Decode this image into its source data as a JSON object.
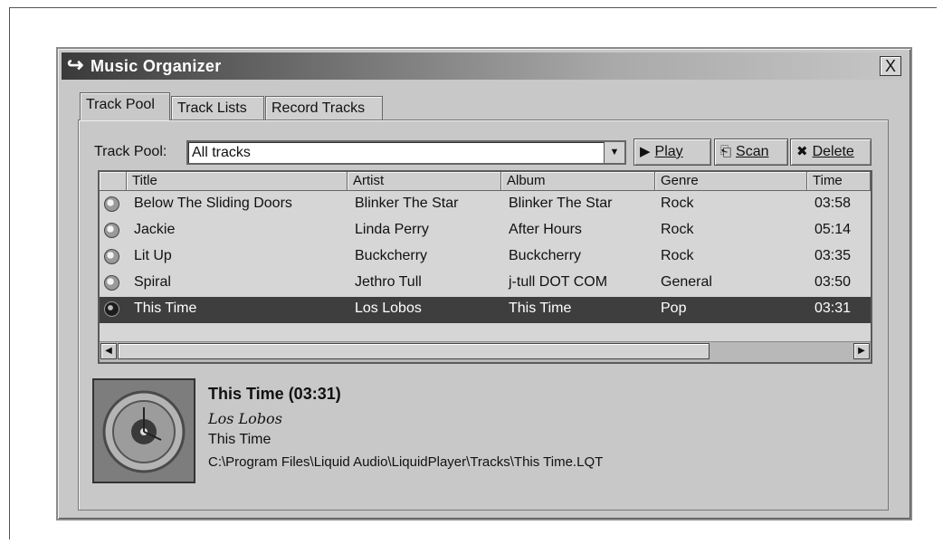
{
  "window": {
    "title": "Music Organizer",
    "close_label": "X"
  },
  "tabs": [
    {
      "label": "Track Pool",
      "active": true
    },
    {
      "label": "Track Lists",
      "active": false
    },
    {
      "label": "Record Tracks",
      "active": false
    }
  ],
  "track_pool": {
    "label": "Track Pool:",
    "selected": "All tracks"
  },
  "buttons": {
    "play": {
      "label": "Play",
      "icon": "play-icon"
    },
    "scan": {
      "label": "Scan",
      "icon": "scan-icon"
    },
    "delete": {
      "label": "Delete",
      "icon": "delete-icon"
    }
  },
  "table": {
    "columns": [
      "Title",
      "Artist",
      "Album",
      "Genre",
      "Time"
    ],
    "rows": [
      {
        "title": "Below The Sliding Doors",
        "artist": "Blinker The Star",
        "album": "Blinker The Star",
        "genre": "Rock",
        "time": "03:58",
        "selected": false
      },
      {
        "title": "Jackie",
        "artist": "Linda Perry",
        "album": "After Hours",
        "genre": "Rock",
        "time": "05:14",
        "selected": false
      },
      {
        "title": "Lit Up",
        "artist": "Buckcherry",
        "album": "Buckcherry",
        "genre": "Rock",
        "time": "03:35",
        "selected": false
      },
      {
        "title": "Spiral",
        "artist": "Jethro Tull",
        "album": "j-tull DOT COM",
        "genre": "General",
        "time": "03:50",
        "selected": false
      },
      {
        "title": "This Time",
        "artist": "Los Lobos",
        "album": "This Time",
        "genre": "Pop",
        "time": "03:31",
        "selected": true
      }
    ]
  },
  "now_selected": {
    "title_line": "This Time (03:31)",
    "artist": "Los Lobos",
    "album": "This Time",
    "path": "C:\\Program Files\\Liquid Audio\\LiquidPlayer\\Tracks\\This Time.LQT"
  },
  "colors": {
    "selection": "#3e3e3e",
    "window_bg": "#c8c8c8"
  }
}
